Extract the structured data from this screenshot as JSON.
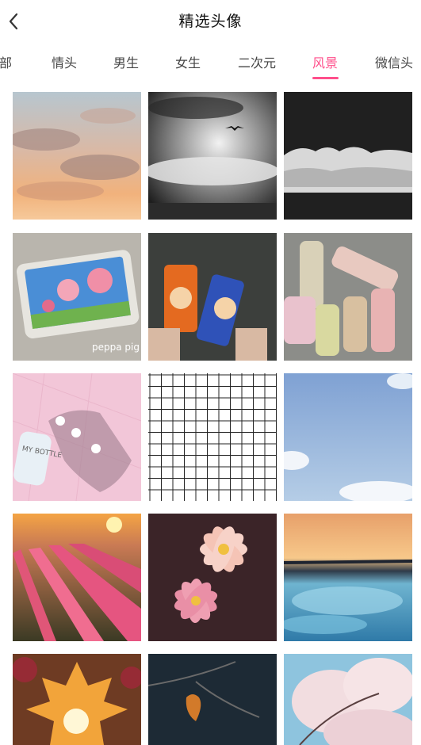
{
  "header": {
    "title": "精选头像",
    "back_icon": "chevron-left-icon"
  },
  "tabs": [
    {
      "label": "全部"
    },
    {
      "label": "情头"
    },
    {
      "label": "男生"
    },
    {
      "label": "女生"
    },
    {
      "label": "二次元"
    },
    {
      "label": "风景",
      "active": true
    },
    {
      "label": "微信头"
    }
  ],
  "colors": {
    "accent": "#ff4f8b"
  },
  "grid": {
    "tiles": [
      {
        "subject": "pastel sunset clouds"
      },
      {
        "subject": "black and white sky with bird"
      },
      {
        "subject": "dark sky with white clouds"
      },
      {
        "subject": "peppa pig on phone",
        "caption": "peppa pig"
      },
      {
        "subject": "two drink cans held in hands"
      },
      {
        "subject": "juice bottles"
      },
      {
        "subject": "bottle and shadow on pink tiles",
        "bottle_text": "MY BOTTLE"
      },
      {
        "subject": "white grid pattern"
      },
      {
        "subject": "blue sky with clouds"
      },
      {
        "subject": "tulip field at sunset"
      },
      {
        "subject": "frangipani flowers"
      },
      {
        "subject": "frozen river at sunset"
      },
      {
        "subject": "autumn leaf with sun"
      },
      {
        "subject": "dry leaf on branch"
      },
      {
        "subject": "cherry blossoms"
      }
    ]
  }
}
